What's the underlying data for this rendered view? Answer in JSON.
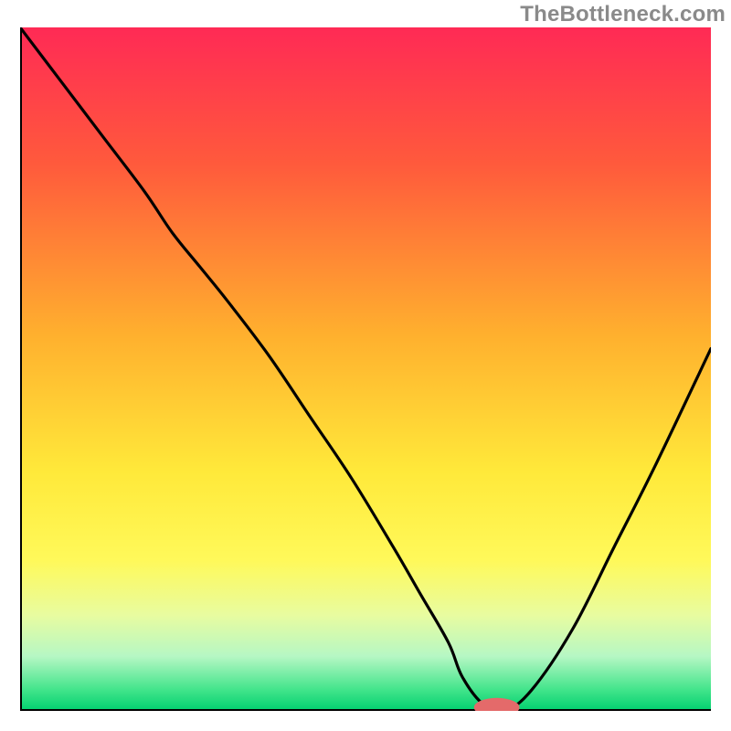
{
  "watermark": "TheBottleneck.com",
  "chart_data": {
    "type": "line",
    "title": "",
    "xlabel": "",
    "ylabel": "",
    "xlim": [
      0,
      100
    ],
    "ylim": [
      0,
      100
    ],
    "gradient_stops": [
      {
        "offset": 0.0,
        "color": "#ff2a55"
      },
      {
        "offset": 0.2,
        "color": "#ff5a3c"
      },
      {
        "offset": 0.45,
        "color": "#ffb02e"
      },
      {
        "offset": 0.65,
        "color": "#ffe93a"
      },
      {
        "offset": 0.78,
        "color": "#fff95a"
      },
      {
        "offset": 0.86,
        "color": "#e8fca0"
      },
      {
        "offset": 0.92,
        "color": "#b6f7c4"
      },
      {
        "offset": 0.97,
        "color": "#40e48a"
      },
      {
        "offset": 1.0,
        "color": "#00cf6f"
      }
    ],
    "series": [
      {
        "name": "bottleneck-curve",
        "x": [
          0,
          6,
          12,
          18,
          22,
          26,
          30,
          36,
          42,
          48,
          54,
          58,
          62,
          64,
          67,
          70,
          74,
          80,
          86,
          92,
          100
        ],
        "y": [
          100,
          92,
          84,
          76,
          70,
          65,
          60,
          52,
          43,
          34,
          24,
          17,
          10,
          5,
          1,
          0,
          3,
          12,
          24,
          36,
          53
        ]
      }
    ],
    "marker": {
      "x": 69,
      "y": 0.5,
      "rx": 3.3,
      "ry": 1.4,
      "color": "#e46a6a"
    },
    "axes": {
      "left": {
        "x1": 0,
        "y1": 0,
        "x2": 0,
        "y2": 100
      },
      "bottom": {
        "x1": 0,
        "y1": 0,
        "x2": 100,
        "y2": 0
      }
    }
  }
}
